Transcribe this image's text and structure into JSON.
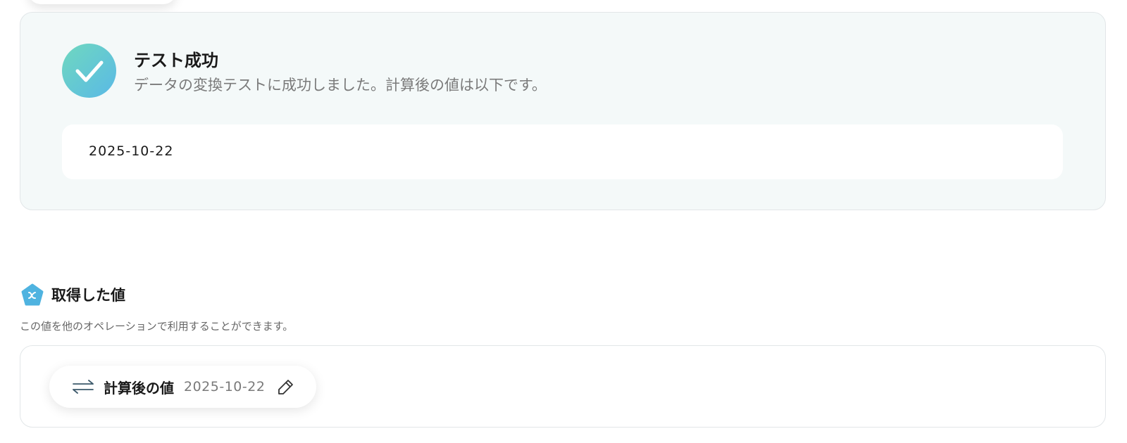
{
  "test_result": {
    "title": "テスト成功",
    "message": "データの変換テストに成功しました。計算後の値は以下です。",
    "value": "2025-10-22",
    "icon": "check-circle-icon",
    "accent_colors": [
      "#6fd8bf",
      "#5ab9e6"
    ]
  },
  "retrieved_values": {
    "title": "取得した値",
    "description": "この値を他のオペレーションで利用することができます。",
    "icon": "variable-icon",
    "items": [
      {
        "label": "計算後の値",
        "value": "2025-10-22",
        "icon": "swap-arrows-icon",
        "action_icon": "pencil-edit-icon"
      }
    ]
  }
}
